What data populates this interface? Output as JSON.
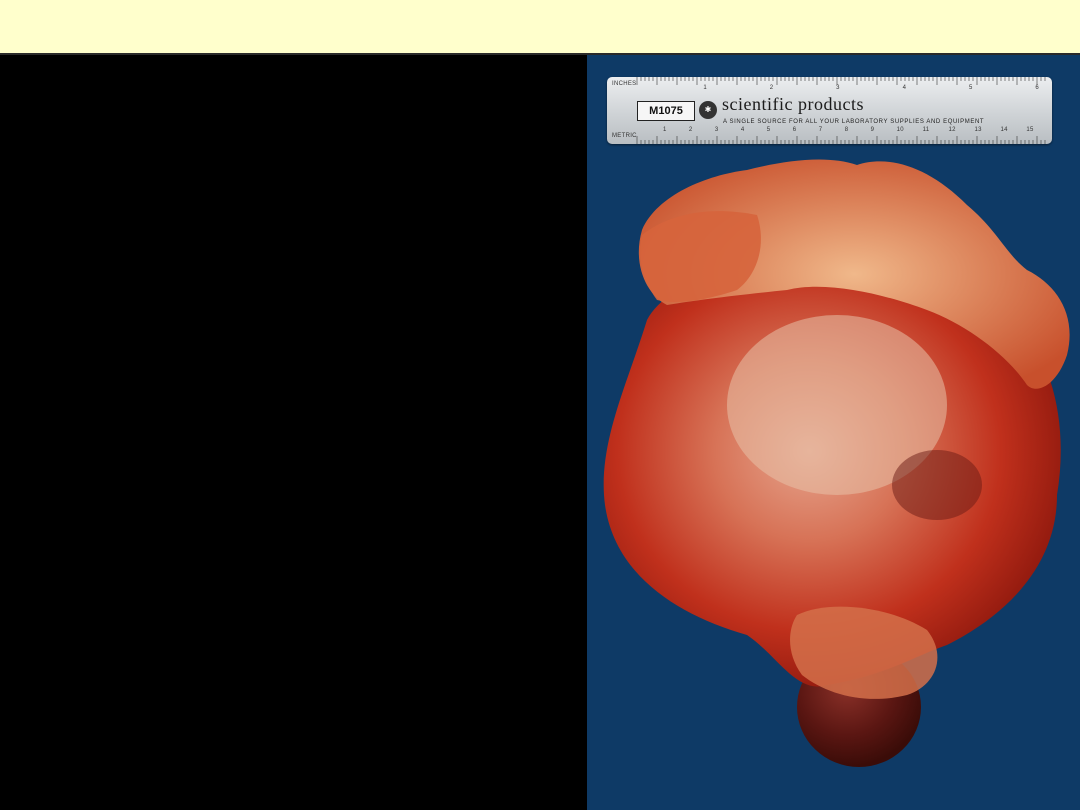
{
  "slide": {
    "banner_color": "#ffffcc",
    "left_panel_color": "#000000",
    "photo_background_color": "#0e3a66"
  },
  "ruler": {
    "inches_label": "INCHES",
    "metric_label": "METRIC",
    "code": "M1075",
    "brand": "scientific products",
    "tagline": "A SINGLE SOURCE FOR ALL YOUR LABORATORY SUPPLIES AND EQUIPMENT",
    "inch_numbers": [
      "1",
      "2",
      "3",
      "4",
      "5",
      "6"
    ],
    "cm_numbers": [
      "1",
      "2",
      "3",
      "4",
      "5",
      "6",
      "7",
      "8",
      "9",
      "10",
      "11",
      "12",
      "13",
      "14",
      "15"
    ]
  },
  "photo": {
    "subject": "gross-specimen-mass",
    "specimen_color": "#c0301c",
    "kidney_color": "#5a1612"
  }
}
